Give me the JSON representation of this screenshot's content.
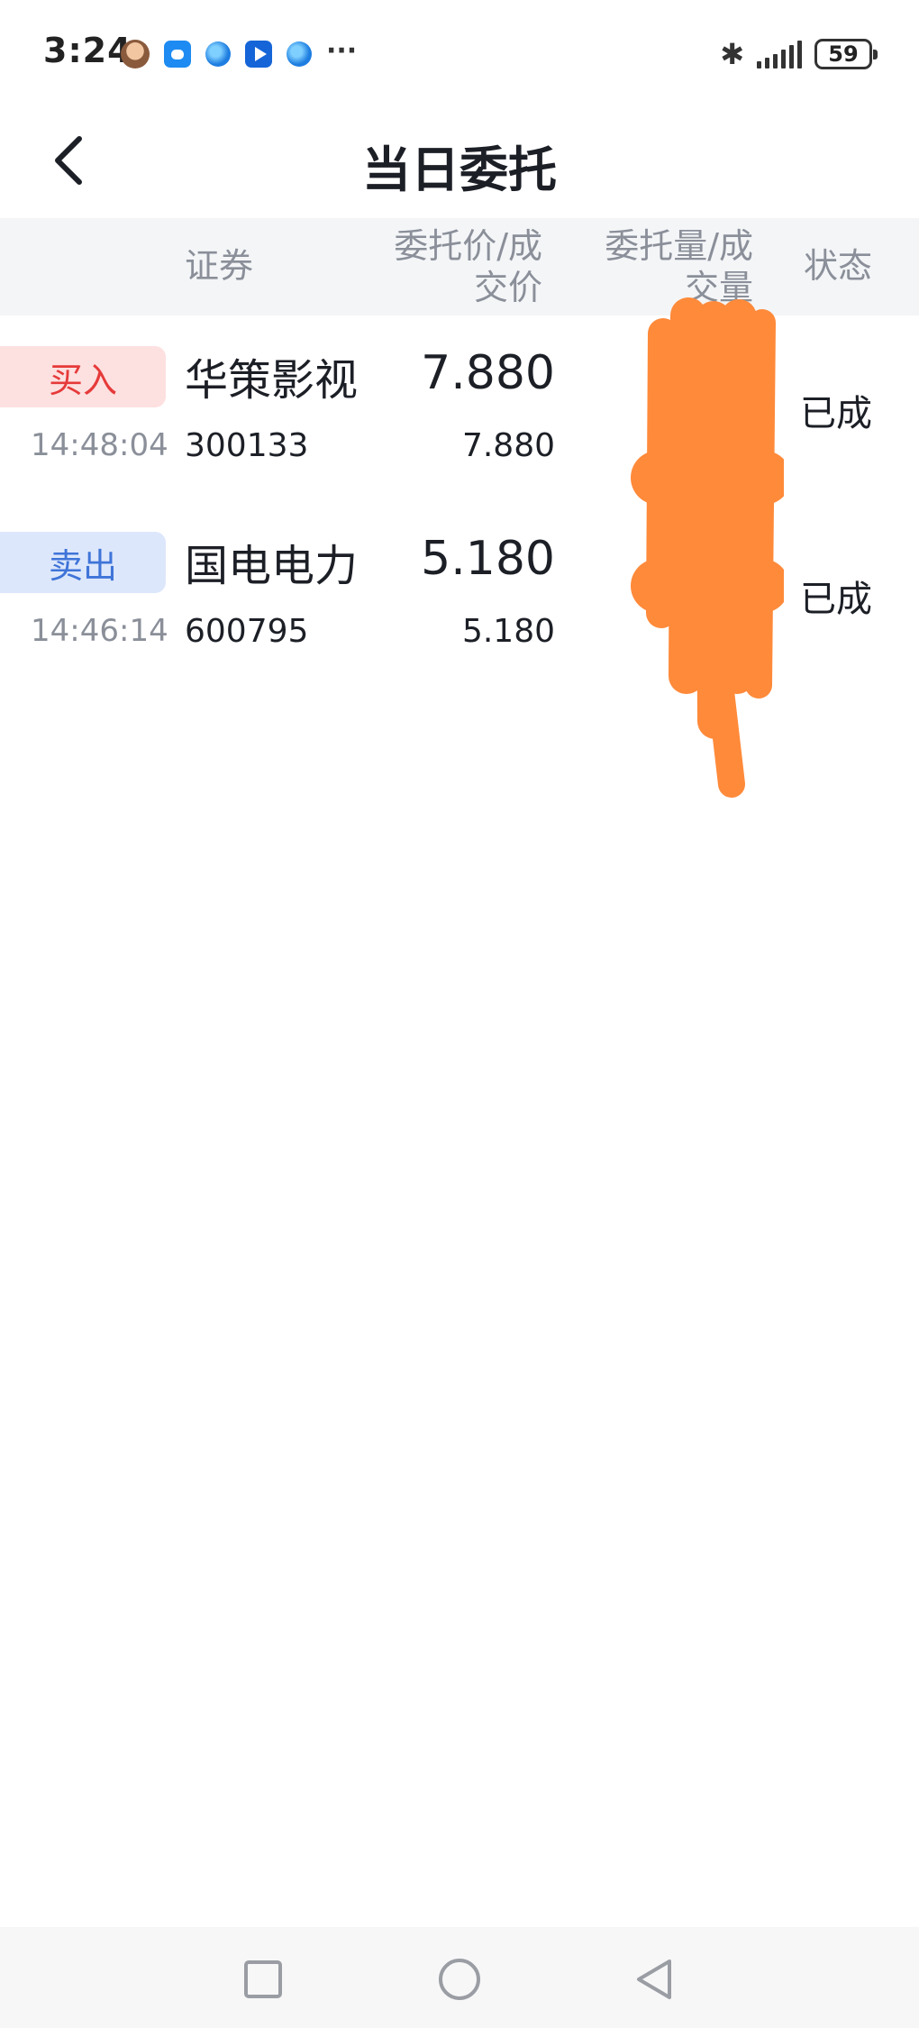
{
  "status_bar": {
    "time": "3:24",
    "more": "···",
    "bluetooth": "✱",
    "battery": "59",
    "notification_icons": [
      "avatar-icon",
      "chat-icon",
      "globe-icon",
      "arrow-app-icon",
      "globe-icon"
    ]
  },
  "header": {
    "title": "当日委托"
  },
  "columns": {
    "security": "证券",
    "price_line1": "委托价/成",
    "price_line2": "交价",
    "qty_line1": "委托量/成",
    "qty_line2": "交量",
    "status": "状态"
  },
  "orders": [
    {
      "side": "买入",
      "time": "14:48:04",
      "name": "华策影视",
      "code": "300133",
      "order_price": "7.880",
      "deal_price": "7.880",
      "status": "已成"
    },
    {
      "side": "卖出",
      "time": "14:46:14",
      "name": "国电电力",
      "code": "600795",
      "order_price": "5.180",
      "deal_price": "5.180",
      "status": "已成"
    }
  ],
  "colors": {
    "buy_text": "#e63a3a",
    "buy_bg": "#fde0e0",
    "sell_text": "#3f74d8",
    "sell_bg": "#dde7fb",
    "header_bg": "#f4f5f7",
    "redaction": "#ff8a3a"
  }
}
